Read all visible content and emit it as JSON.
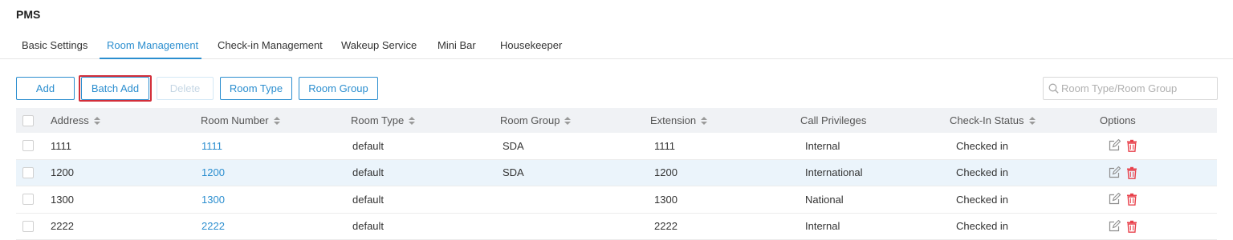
{
  "app_title": "PMS",
  "tabs": [
    {
      "label": "Basic Settings"
    },
    {
      "label": "Room Management"
    },
    {
      "label": "Check-in Management"
    },
    {
      "label": "Wakeup Service"
    },
    {
      "label": "Mini Bar"
    },
    {
      "label": "Housekeeper"
    }
  ],
  "active_tab": "Room Management",
  "toolbar": {
    "add": "Add",
    "batch_add": "Batch Add",
    "delete": "Delete",
    "room_type": "Room Type",
    "room_group": "Room Group"
  },
  "search": {
    "placeholder": "Room Type/Room Group",
    "value": ""
  },
  "table": {
    "columns": [
      "Address",
      "Room Number",
      "Room Type",
      "Room Group",
      "Extension",
      "Call Privileges",
      "Check-In Status",
      "Options"
    ],
    "rows": [
      {
        "address": "1111",
        "room_number": "1111",
        "room_type": "default",
        "room_group": "SDA",
        "extension": "1111",
        "call_privileges": "Internal",
        "status": "Checked in"
      },
      {
        "address": "1200",
        "room_number": "1200",
        "room_type": "default",
        "room_group": "SDA",
        "extension": "1200",
        "call_privileges": "International",
        "status": "Checked in"
      },
      {
        "address": "1300",
        "room_number": "1300",
        "room_type": "default",
        "room_group": "",
        "extension": "1300",
        "call_privileges": "National",
        "status": "Checked in"
      },
      {
        "address": "2222",
        "room_number": "2222",
        "room_type": "default",
        "room_group": "",
        "extension": "2222",
        "call_privileges": "Internal",
        "status": "Checked in"
      }
    ]
  },
  "icons": {
    "edit": "edit-icon",
    "delete": "trash-icon",
    "search": "search-icon",
    "sort": "sort-icon"
  },
  "colors": {
    "accent": "#2b8ecf",
    "danger": "#e8414b",
    "highlight_row": "#ebf4fb",
    "callout": "#d32f3a"
  }
}
